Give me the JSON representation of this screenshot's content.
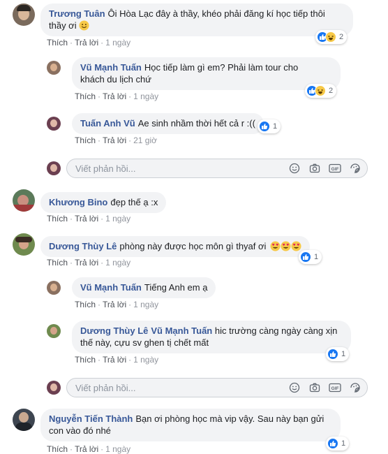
{
  "labels": {
    "like": "Thích",
    "reply": "Trả lời",
    "dot": "·",
    "reply_placeholder": "Viết phản hồi..."
  },
  "comments": [
    {
      "author": "Trương Tuân",
      "text": "Ôi Hòa Lạc đây à thầy, khéo phải đăng kí học tiếp thôi",
      "text2": "thầy ơi",
      "time": "1 ngày",
      "reactions": "2",
      "avatar_color": "#7a6a5c"
    },
    {
      "author": "Vũ Mạnh Tuấn",
      "text": "Học tiếp làm gì em? Phải làm tour cho",
      "text2": "khách du lịch chứ",
      "time": "1 ngày",
      "reactions": "2",
      "avatar_color": "#8a7060"
    },
    {
      "author": "Tuấn Anh Vũ",
      "text": "Ae sinh nhầm thời hết cả r :((",
      "time": "21 giờ",
      "reactions": "1",
      "avatar_color": "#6b3f50"
    },
    {
      "author": "Khương Bino",
      "text": "đẹp thế ạ :x",
      "time": "1 ngày",
      "avatar_color": "#5b7a5a"
    },
    {
      "author": "Dương Thùy Lê",
      "text": "phòng này được học môn gì thyaf ơi",
      "time": "1 ngày",
      "reactions": "1",
      "avatar_color": "#6f8a4e"
    },
    {
      "author": "Vũ Mạnh Tuấn",
      "text": "Tiếng Anh em ạ",
      "time": "1 ngày",
      "avatar_color": "#8a7060"
    },
    {
      "author": "Dương Thùy Lê",
      "mention": "Vũ Mạnh Tuấn",
      "text": "hic trường càng ngày càng xịn",
      "text2": "thế này, cựu sv ghen tị chết mất",
      "time": "1 ngày",
      "reactions": "1",
      "avatar_color": "#6f8a4e"
    },
    {
      "author": "Nguyễn Tiến Thành",
      "text": "Bạn ơi phòng học mà vip vậy. Sau này bạn gửi",
      "text2": "con vào đó nhé",
      "time": "1 ngày",
      "reactions": "1",
      "avatar_color": "#3d4550"
    }
  ],
  "icons": {
    "like": "thumbs-up-icon",
    "haha": "haha-emoji-icon",
    "heart_eyes": "heart-eyes-emoji-icon",
    "smile": "smile-emoji-icon",
    "emoji": "emoji-icon",
    "camera": "camera-icon",
    "gif": "gif-icon",
    "sticker": "sticker-icon"
  },
  "colors": {
    "author": "#385898",
    "bubble": "#f2f3f5",
    "like": "#1877f2"
  }
}
